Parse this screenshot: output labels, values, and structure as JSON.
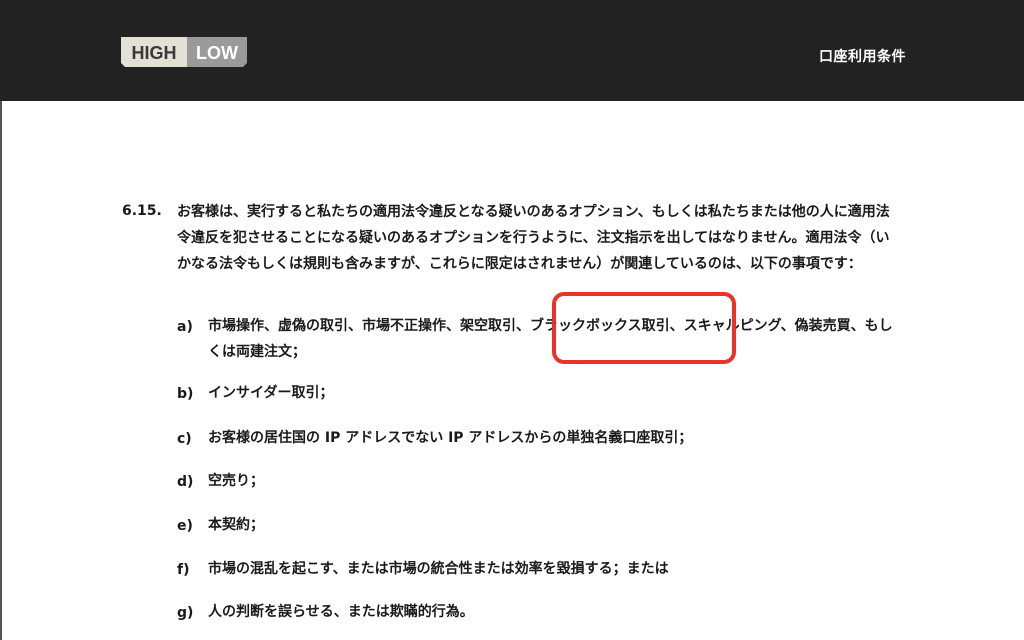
{
  "header": {
    "logo": {
      "left_text": "HIGH",
      "right_text": "LOW",
      "colors": {
        "left_plate": "#e2e1d4",
        "right_plate": "#9a9a9a",
        "left_text": "#3a3a3a",
        "right_text": "#ffffff"
      }
    },
    "title": "口座利用条件"
  },
  "section": {
    "number": "6.15.",
    "body": "お客様は、実行すると私たちの適用法令違反となる疑いのあるオプション、もしくは私たちまたは他の人に適用法令違反を犯させることになる疑いのあるオプションを行うように、注文指示を出してはなりません。適用法令（いかなる法令もしくは規則も含みますが、これらに限定はされません）が関連しているのは、以下の事項です："
  },
  "items": [
    {
      "letter": "a)",
      "text": "市場操作、虚偽の取引、市場不正操作、架空取引、ブラックボックス取引、スキャルピング、偽装売買、もしくは両建注文；"
    },
    {
      "letter": "b)",
      "text": "インサイダー取引；"
    },
    {
      "letter": "c)",
      "text": "お客様の居住国の IP アドレスでない IP アドレスからの単独名義口座取引；"
    },
    {
      "letter": "d)",
      "text": "空売り；"
    },
    {
      "letter": "e)",
      "text": "本契約；"
    },
    {
      "letter": "f)",
      "text": "市場の混乱を起こす、または市場の統合性または効率を毀損する；または"
    },
    {
      "letter": "g)",
      "text": "人の判断を誤らせる、または欺瞞的行為。"
    }
  ],
  "annotation": {
    "highlighted_term": "ブラックボックス取引",
    "color": "#e8322a"
  }
}
